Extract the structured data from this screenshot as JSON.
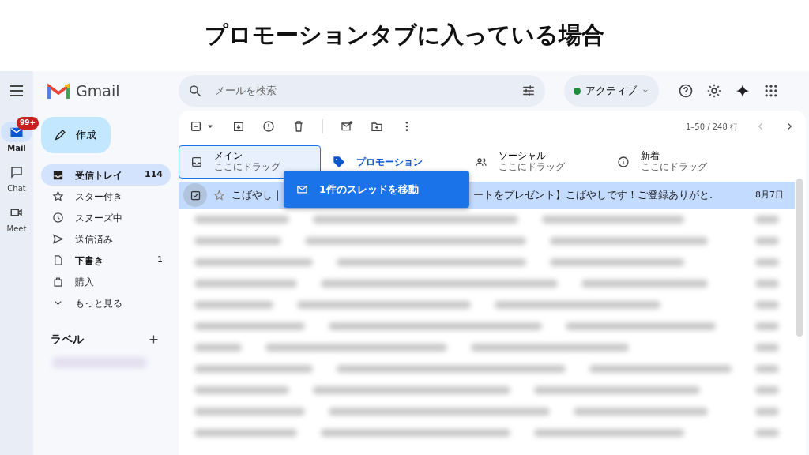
{
  "caption": "プロモーションタブに入っている場合",
  "rail": [
    {
      "label": "Mail",
      "selected": true,
      "badge": "99+"
    },
    {
      "label": "Chat",
      "selected": false
    },
    {
      "label": "Meet",
      "selected": false
    }
  ],
  "logo": "Gmail",
  "compose": "作成",
  "sidebar": {
    "items": [
      {
        "label": "受信トレイ",
        "count": "114",
        "selected": true,
        "bold": true
      },
      {
        "label": "スター付き",
        "selected": false,
        "bold": false
      },
      {
        "label": "スヌーズ中",
        "selected": false,
        "bold": false
      },
      {
        "label": "送信済み",
        "selected": false,
        "bold": false
      },
      {
        "label": "下書き",
        "count": "1",
        "selected": false,
        "bold": true
      },
      {
        "label": "購入",
        "selected": false,
        "bold": false
      },
      {
        "label": "もっと見る",
        "selected": false,
        "bold": false
      }
    ],
    "labels_heading": "ラベル"
  },
  "search": {
    "placeholder": "メールを検索"
  },
  "status": {
    "label": "アクティブ",
    "color": "#1e8e3e"
  },
  "pager": "1–50 / 248 行",
  "tabs": [
    {
      "title": "メイン",
      "subtitle": "ここにドラッグ",
      "selected": false,
      "drop_target": true
    },
    {
      "title": "プロモーション",
      "selected": true,
      "drop_target": false
    },
    {
      "title": "ソーシャル",
      "subtitle": "ここにドラッグ",
      "selected": false,
      "drop_target": false
    },
    {
      "title": "新着",
      "subtitle": "ここにドラッグ",
      "selected": false,
      "drop_target": false
    }
  ],
  "email": {
    "checked": true,
    "starred": false,
    "sender": "こばやし｜",
    "subject": "ートをプレゼント】こばやしです！ご登録ありがと.",
    "date": "8月7日",
    "selected": true
  },
  "drag_tooltip": "1件のスレッドを移動"
}
